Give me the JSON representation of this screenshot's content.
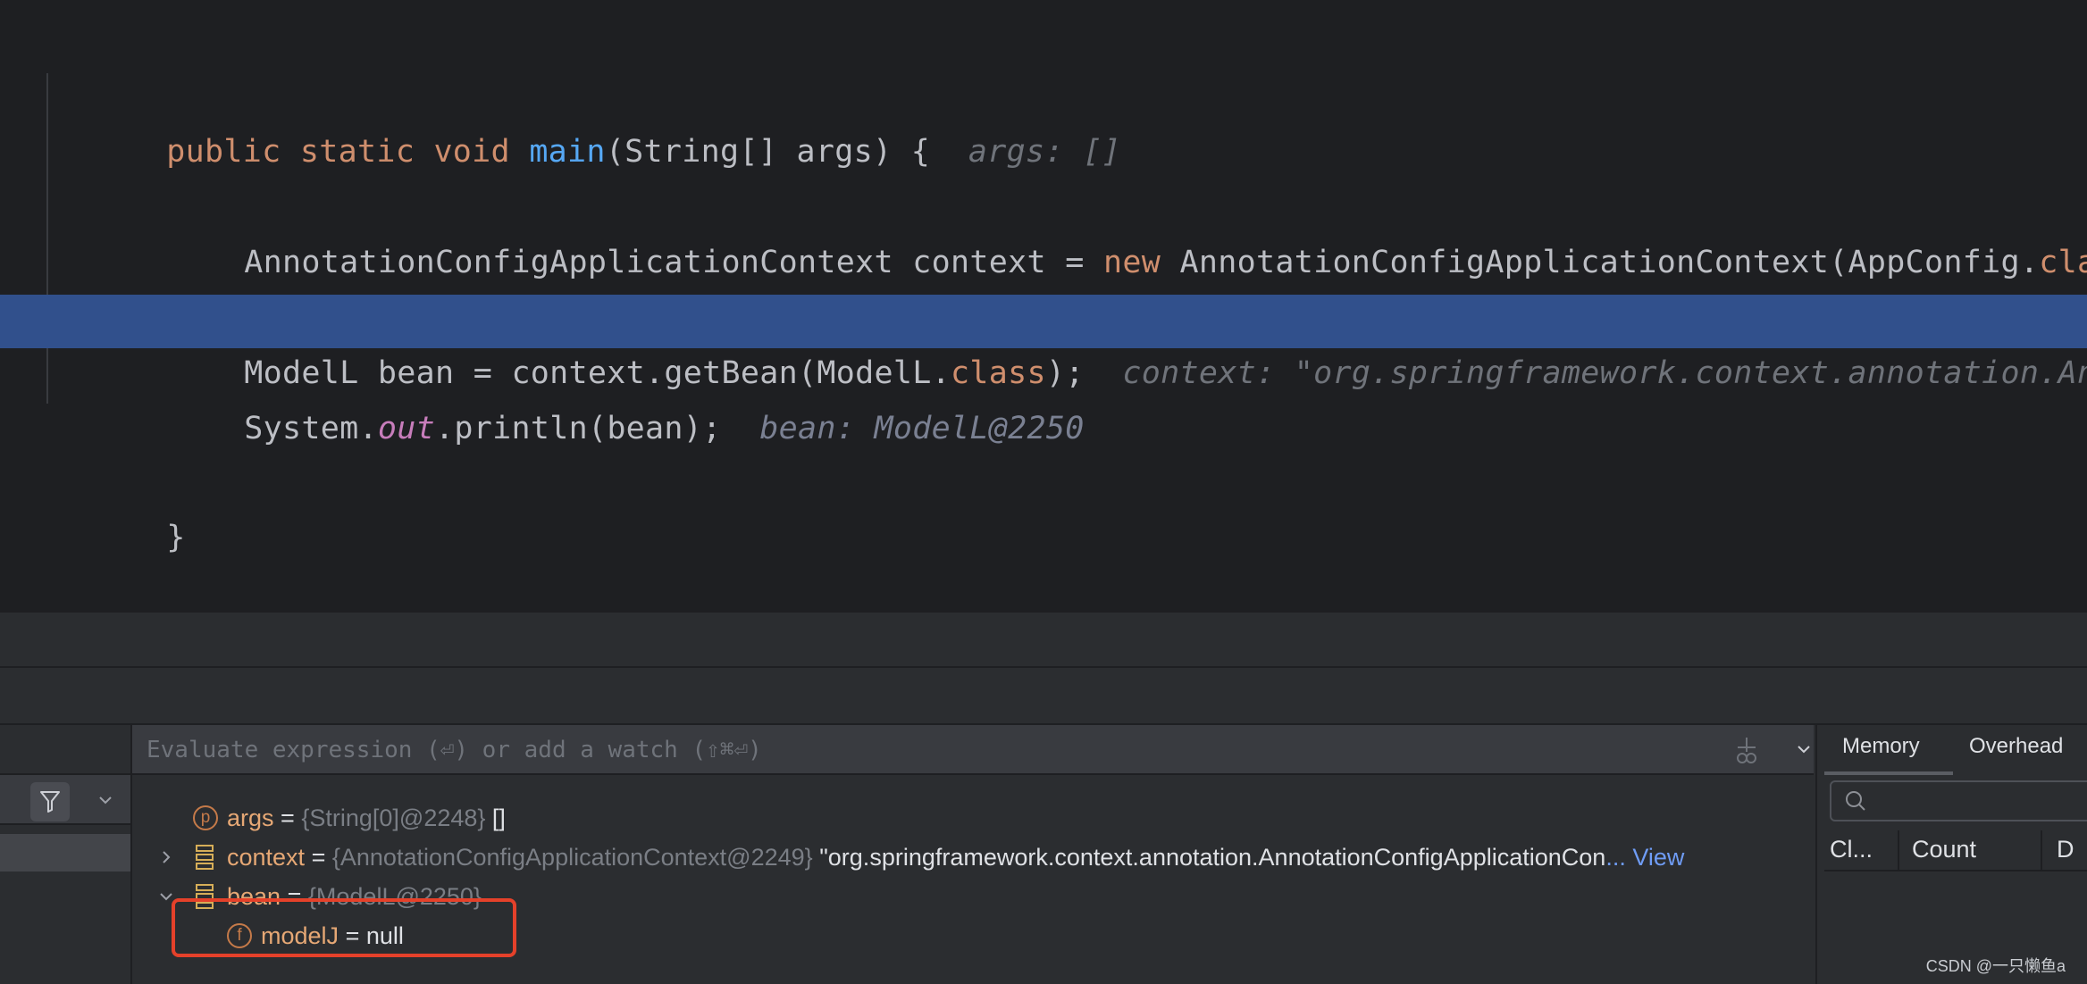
{
  "editor": {
    "lines": [
      {
        "tokens": [
          {
            "text": "public static void ",
            "cls": "kw"
          },
          {
            "text": "main",
            "cls": "fn"
          },
          {
            "text": "(String[] args) {",
            "cls": ""
          }
        ],
        "hint": "args: []"
      },
      {
        "tokens": [
          {
            "text": "AnnotationConfigApplicationContext context = ",
            "cls": ""
          },
          {
            "text": "new",
            "cls": "kw"
          },
          {
            "text": " AnnotationConfigApplicationContext(AppConfig.",
            "cls": ""
          },
          {
            "text": "class",
            "cls": "kw"
          },
          {
            "text": ");",
            "cls": ""
          }
        ],
        "hint": ""
      },
      {
        "tokens": [
          {
            "text": "ModelL bean = context.getBean(ModelL.",
            "cls": ""
          },
          {
            "text": "class",
            "cls": "kw"
          },
          {
            "text": ");",
            "cls": ""
          }
        ],
        "hint": "context: \"org.springframework.context.annotation.AnnotationConfigApplicationContext@"
      },
      {
        "tokens": [
          {
            "text": "System.",
            "cls": ""
          },
          {
            "text": "out",
            "cls": "st"
          },
          {
            "text": ".println(bean);",
            "cls": ""
          }
        ],
        "hint": "bean: ModelL@2250",
        "current": true
      },
      {
        "tokens": [
          {
            "text": "}",
            "cls": ""
          }
        ],
        "hint": ""
      }
    ]
  },
  "debugger": {
    "evaluate_placeholder": "Evaluate expression (⏎) or add a watch (⇧⌘⏎)",
    "variables": [
      {
        "name": "args",
        "kind": "p",
        "type": "{String[0]@2248}",
        "value": "[]",
        "expandable": false
      },
      {
        "name": "context",
        "kind": "obj",
        "type": "{AnnotationConfigApplicationContext@2249}",
        "value": "\"org.springframework.context.annotation.AnnotationConfigApplicationCon",
        "truncation": "...",
        "link": "View",
        "expandable": true,
        "expanded": false
      },
      {
        "name": "bean",
        "kind": "obj",
        "type": "{ModelL@2250}",
        "value": "",
        "expandable": true,
        "expanded": true
      },
      {
        "name": "modelJ",
        "kind": "f",
        "type": "",
        "value": "null",
        "child": true,
        "highlighted": true
      }
    ]
  },
  "memory": {
    "tabs": [
      "Memory",
      "Overhead"
    ],
    "active_tab": "Memory",
    "search_value": "",
    "columns": [
      "Cl...",
      "Count",
      "D"
    ]
  },
  "watermark": "CSDN @一只懒鱼a",
  "colors": {
    "current_line": "#31508c",
    "highlight_box": "#e5412a",
    "keyword": "#cf8e6d",
    "function": "#56a8f5",
    "static_field": "#c77dbb"
  }
}
